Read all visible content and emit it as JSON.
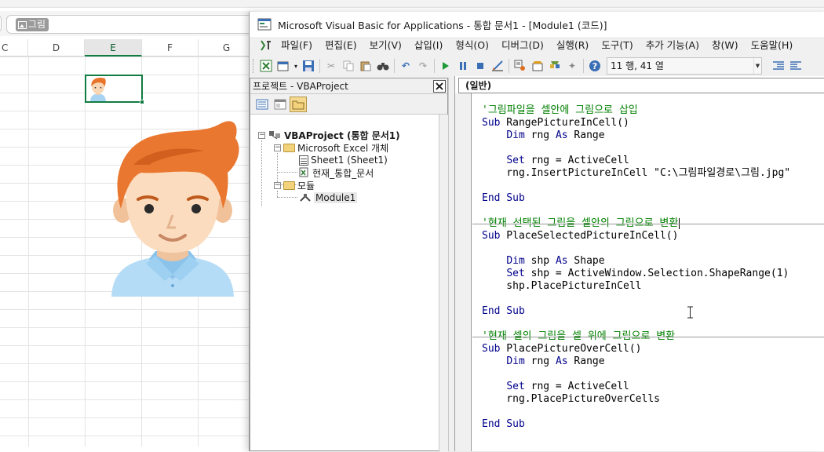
{
  "excel": {
    "formula_chip_text": "그림",
    "columns": [
      "C",
      "D",
      "E",
      "F",
      "G"
    ],
    "selected_column": "E"
  },
  "vbe": {
    "title": "Microsoft Visual Basic for Applications - 통합 문서1 - [Module1 (코드)]",
    "menu": [
      "파일(F)",
      "편집(E)",
      "보기(V)",
      "삽입(I)",
      "형식(O)",
      "디버그(D)",
      "실행(R)",
      "도구(T)",
      "추가 기능(A)",
      "창(W)",
      "도움말(H)"
    ],
    "toolbar_position": "11 행, 41 열",
    "project_panel": {
      "title": "프로젝트 - VBAProject",
      "tree": {
        "root": "VBAProject (통합 문서1)",
        "excel_objects_folder": "Microsoft Excel 개체",
        "sheet1": "Sheet1 (Sheet1)",
        "workbook": "현재_통합_문서",
        "modules_folder": "모듈",
        "module1": "Module1"
      }
    },
    "code_window": {
      "object_combo": "(일반)",
      "lines": [
        {
          "type": "comment",
          "text": "'그림파일을 셀안에 그림으로 삽입"
        },
        {
          "type": "code",
          "text": "Sub RangePictureInCell()"
        },
        {
          "type": "code",
          "text": "    Dim rng As Range"
        },
        {
          "type": "blank",
          "text": ""
        },
        {
          "type": "code",
          "text": "    Set rng = ActiveCell"
        },
        {
          "type": "code",
          "text": "    rng.InsertPictureInCell \"C:\\그림파일경로\\그림.jpg\""
        },
        {
          "type": "blank",
          "text": ""
        },
        {
          "type": "code",
          "text": "End Sub"
        },
        {
          "type": "comment",
          "text": "'현재 선택된 그림을 셀안의 그림으로 변환"
        },
        {
          "type": "code",
          "text": "Sub PlaceSelectedPictureInCell()"
        },
        {
          "type": "blank",
          "text": ""
        },
        {
          "type": "code",
          "text": "    Dim shp As Shape"
        },
        {
          "type": "code",
          "text": "    Set shp = ActiveWindow.Selection.ShapeRange(1)"
        },
        {
          "type": "code",
          "text": "    shp.PlacePictureInCell"
        },
        {
          "type": "blank",
          "text": ""
        },
        {
          "type": "code",
          "text": "End Sub"
        },
        {
          "type": "comment",
          "text": "'현재 셀의 그림을 셀 위에 그림으로 변환"
        },
        {
          "type": "code",
          "text": "Sub PlacePictureOverCell()"
        },
        {
          "type": "code",
          "text": "    Dim rng As Range"
        },
        {
          "type": "blank",
          "text": ""
        },
        {
          "type": "code",
          "text": "    Set rng = ActiveCell"
        },
        {
          "type": "code",
          "text": "    rng.PlacePictureOverCells"
        },
        {
          "type": "blank",
          "text": ""
        },
        {
          "type": "code",
          "text": "End Sub"
        }
      ]
    }
  },
  "colors": {
    "excel_green": "#107c41",
    "vba_keyword": "#00008b",
    "vba_comment": "#008000"
  }
}
